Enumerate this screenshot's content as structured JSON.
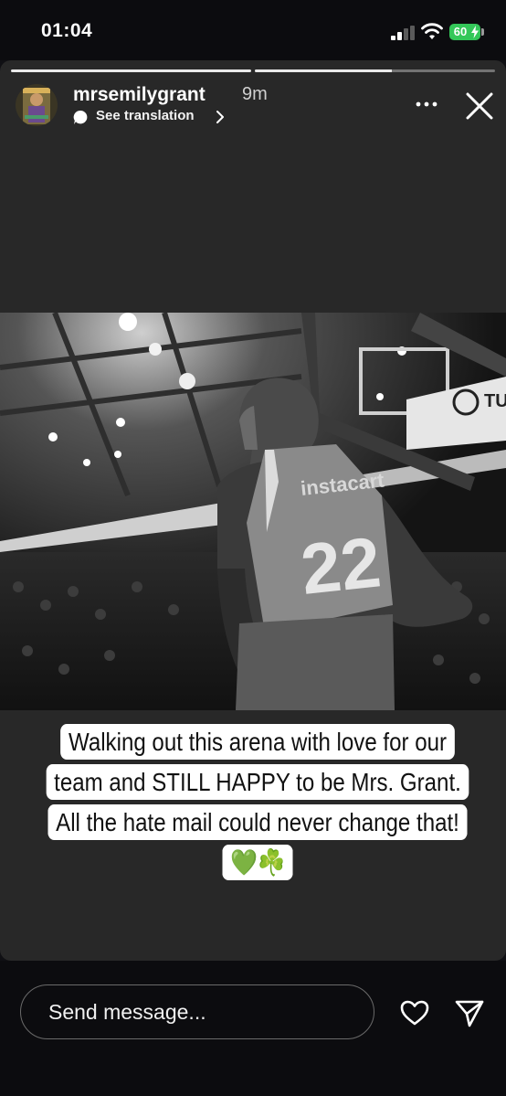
{
  "status_bar": {
    "time": "01:04",
    "battery_level": "60",
    "battery_color": "#34c759",
    "icons": [
      "signal-icon",
      "wifi-icon",
      "battery-icon"
    ]
  },
  "story": {
    "progress_segments": [
      1.0,
      0.6
    ],
    "username": "mrsemilygrant",
    "time_ago": "9m",
    "translation_label": "See translation",
    "icons": [
      "translate-icon",
      "chevron-right-icon",
      "more-icon",
      "close-icon"
    ],
    "photo_description_colors": {
      "background": "#282828"
    },
    "caption": "Walking out this arena with love for our team and STILL HAPPY to be Mrs. Grant. All the hate mail could never change that! 💚☘️"
  },
  "reply_bar": {
    "placeholder": "Send message...",
    "icons": [
      "heart-icon",
      "send-icon"
    ]
  }
}
